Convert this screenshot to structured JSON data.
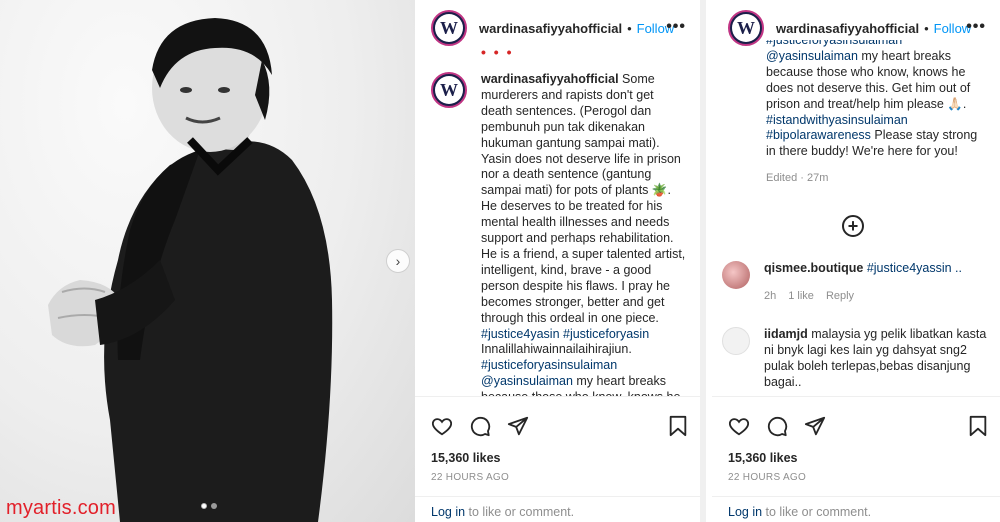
{
  "colors": {
    "accent": "#0095f6",
    "hashtag": "#00376b",
    "watermark": "#e2202a"
  },
  "watermark": "myartis.com",
  "post": {
    "username": "wardinasafiyyahofficial",
    "separator": "•",
    "follow_label": "Follow",
    "more_label": "•••",
    "likes": "15,360 likes",
    "time": "22 HOURS AGO",
    "login_link": "Log in",
    "login_rest": " to like or comment."
  },
  "caption": {
    "segments": [
      {
        "t": "text",
        "v": " Some murderers and rapists don't get death sentences. (Perogol dan pembunuh pun tak dikenakan hukuman gantung sampai mati). Yasin does not deserve life in prison nor a death sentence (gantung sampai mati) for pots of plants 🪴. He deserves to be treated for his mental health illnesses and needs support and perhaps rehabilitation. He is a friend, a super talented artist, intelligent, kind, brave - a good person despite his flaws. I pray he becomes stronger, better and get through this ordeal in one piece. "
      },
      {
        "t": "tag",
        "v": "#justice4yasin"
      },
      {
        "t": "text",
        "v": " "
      },
      {
        "t": "tag",
        "v": "#justiceforyasin"
      },
      {
        "t": "text",
        "v": " Innalillahiwainnailaihirajiun. "
      },
      {
        "t": "tag",
        "v": "#justiceforyasinsulaiman"
      },
      {
        "t": "text",
        "v": " "
      },
      {
        "t": "tag",
        "v": "@yasinsulaiman"
      },
      {
        "t": "text",
        "v": " my heart breaks because those who know, knows he does not deserve this. Get him out of prison and treat/help him please 🙏🏻."
      }
    ]
  },
  "caption_b": {
    "segments": [
      {
        "t": "tag",
        "v": "#justiceforyasinsulaiman"
      },
      {
        "t": "text",
        "v": " "
      },
      {
        "t": "tag",
        "v": "@yasinsulaiman"
      },
      {
        "t": "text",
        "v": " my heart breaks because those who know, knows he does not deserve this. Get him out of prison and treat/help him please 🙏🏻. "
      },
      {
        "t": "tag",
        "v": "#istandwithyasinsulaiman"
      },
      {
        "t": "text",
        "v": " "
      },
      {
        "t": "tag",
        "v": "#bipolarawareness"
      },
      {
        "t": "text",
        "v": " Please stay strong in there buddy! We're here for you!"
      }
    ],
    "edited": "Edited · 27m",
    "load_more": "+"
  },
  "comments": [
    {
      "username": "qismee.boutique",
      "text": "#justice4yassin ..",
      "text_is_tag": true,
      "age": "2h",
      "likes": "1 like",
      "reply": "Reply"
    },
    {
      "username": "iidamjd",
      "text": " malaysia yg pelik libatkan kasta ni bnyk lagi kes lain yg dahsyat sng2 pulak boleh terlepas,bebas disanjung bagai..",
      "text_is_tag": false
    }
  ],
  "photo": {
    "carousel_next": "›"
  },
  "icons": [
    "heart-icon",
    "comment-icon",
    "share-icon",
    "bookmark-icon",
    "plus-circle-icon",
    "more-icon",
    "chevron-right-icon"
  ]
}
